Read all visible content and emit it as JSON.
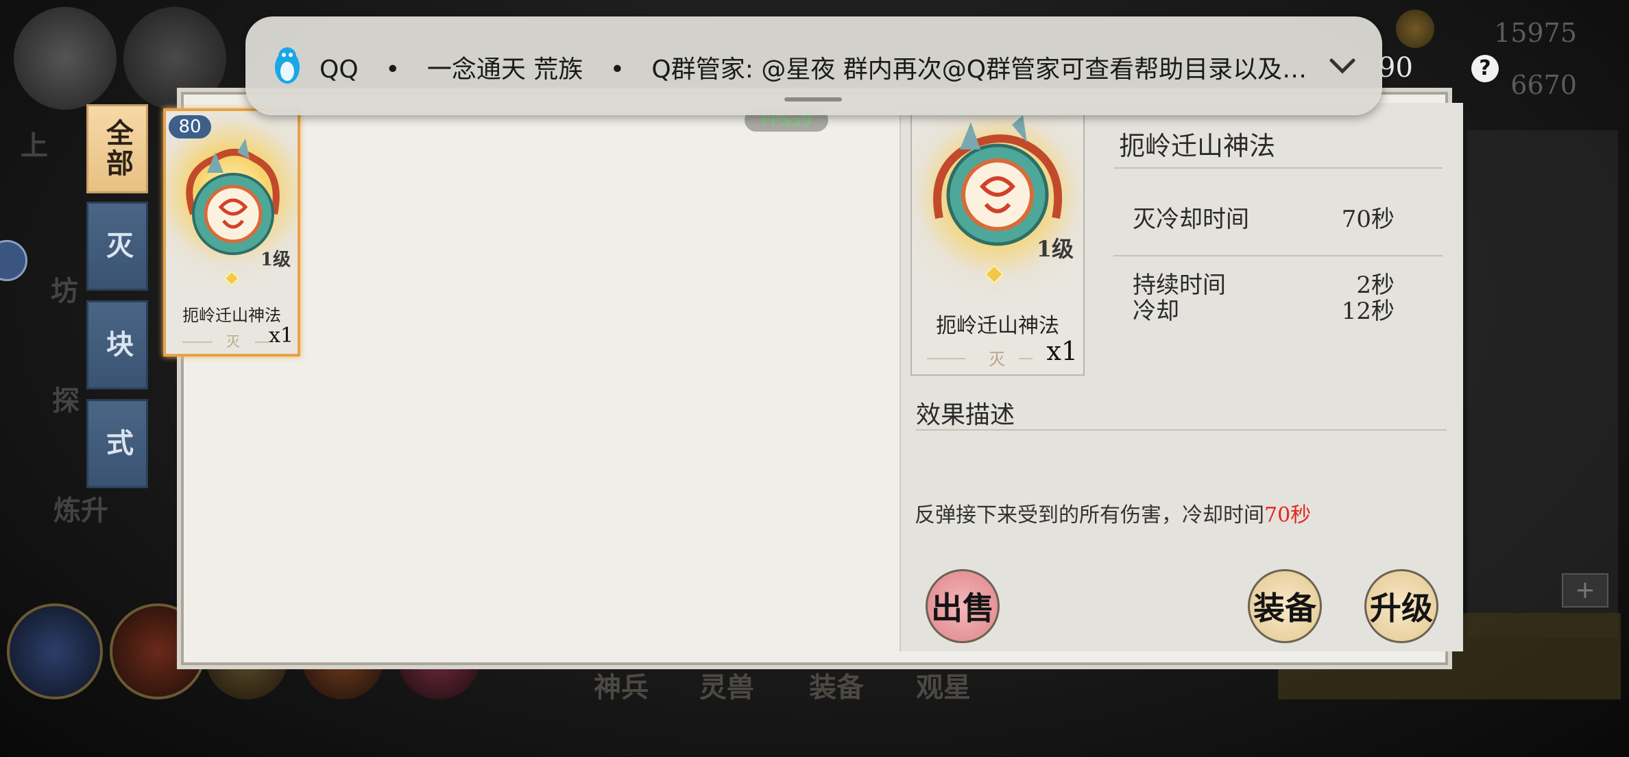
{
  "resources": {
    "top": "15975",
    "bottom": "6670",
    "level": "90",
    "help": "?"
  },
  "background": {
    "left_labels": [
      "上",
      "坊",
      "探",
      "炼升"
    ],
    "bottom_labels": [
      "神兵",
      "灵兽",
      "装备",
      "观星"
    ]
  },
  "notification": {
    "app": "QQ",
    "group": "一念通天 荒族",
    "message": "Q群管家: @星夜 群内再次@Q群管家可查看帮助目录以及…",
    "separator": "•"
  },
  "fps": "FPS59",
  "tabs": [
    {
      "label": "全部",
      "active": true
    },
    {
      "label": "灭",
      "active": false
    },
    {
      "label": "块",
      "active": false
    },
    {
      "label": "式",
      "active": false
    }
  ],
  "inventory": [
    {
      "name": "扼岭迁山神法",
      "level": "1级",
      "count": "x1",
      "element": "灭",
      "badge": "80",
      "selected": true
    }
  ],
  "detail": {
    "name": "扼岭迁山神法",
    "card_name": "扼岭迁山神法",
    "card_level": "1级",
    "card_count": "x1",
    "card_element": "灭",
    "stats": [
      {
        "label": "灭冷却时间",
        "value": "70秒"
      },
      {
        "label": "持续时间",
        "value": "2秒"
      },
      {
        "label": "冷却",
        "value": "12秒"
      }
    ],
    "effect_title": "效果描述",
    "effect_text": "反弹接下来受到的所有伤害，冷却时间",
    "effect_highlight": "70秒",
    "buttons": {
      "sell": "出售",
      "equip": "装备",
      "upgrade": "升级"
    }
  },
  "colors": {
    "highlight": "#e5261f",
    "tab_active": "#f0cd95",
    "tab_inactive": "#42597a",
    "qq_blue": "#19a7e8"
  }
}
